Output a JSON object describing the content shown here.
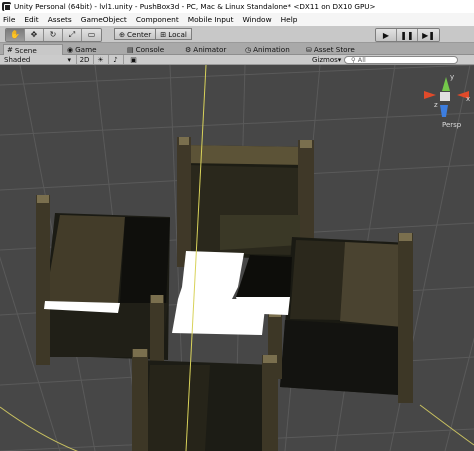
{
  "window": {
    "title": "Unity Personal (64bit) - lvl1.unity - PushBox3d - PC, Mac & Linux Standalone* <DX11 on DX10 GPU>"
  },
  "menubar": {
    "items": [
      "File",
      "Edit",
      "Assets",
      "GameObject",
      "Component",
      "Mobile Input",
      "Window",
      "Help"
    ]
  },
  "toolbar": {
    "tools": [
      {
        "name": "hand-tool",
        "glyph": "✋"
      },
      {
        "name": "move-tool",
        "glyph": "✥"
      },
      {
        "name": "rotate-tool",
        "glyph": "↻"
      },
      {
        "name": "scale-tool",
        "glyph": "⤢"
      },
      {
        "name": "rect-tool",
        "glyph": "▭"
      }
    ],
    "active_tool": "hand-tool",
    "pivot": {
      "label": "Center",
      "icon": "pivot-icon"
    },
    "space": {
      "label": "Local",
      "icon": "local-icon"
    },
    "play": {
      "play_glyph": "▶",
      "pause_glyph": "❚❚",
      "step_glyph": "▶❚"
    }
  },
  "tabs": [
    {
      "label": "Scene",
      "icon": "scene-icon",
      "glyph": "#",
      "active": true
    },
    {
      "label": "Game",
      "icon": "game-icon",
      "glyph": "◉",
      "active": false
    },
    {
      "label": "Console",
      "icon": "console-icon",
      "glyph": "▤",
      "active": false
    },
    {
      "label": "Animator",
      "icon": "animator-icon",
      "glyph": "⚙",
      "active": false
    },
    {
      "label": "Animation",
      "icon": "animation-icon",
      "glyph": "◷",
      "active": false
    },
    {
      "label": "Asset Store",
      "icon": "asset-store-icon",
      "glyph": "⛁",
      "active": false
    }
  ],
  "scene_toolbar": {
    "shading_mode": "Shaded",
    "mode_2d": "2D",
    "lighting_glyph": "☀",
    "audio_glyph": "♪",
    "effects_glyph": "▣",
    "gizmos_label": "Gizmos",
    "search_placeholder": "All"
  },
  "viewport": {
    "projection_label": "Persp",
    "gizmo_axes": {
      "y": "y",
      "x": "x",
      "z": "z"
    },
    "colors": {
      "background": "#474747",
      "grid": "#5a5a5a",
      "white_floor": "#ffffff",
      "wall_dark": "#141410",
      "wall_mid": "#3a3424",
      "stone_top": "#5c5337",
      "pillar": "#7a6f4e",
      "axis_yellow": "#d8d25a",
      "gizmo_red": "#e04a2a",
      "gizmo_green": "#74c84a",
      "gizmo_blue": "#3d7ee0"
    }
  }
}
